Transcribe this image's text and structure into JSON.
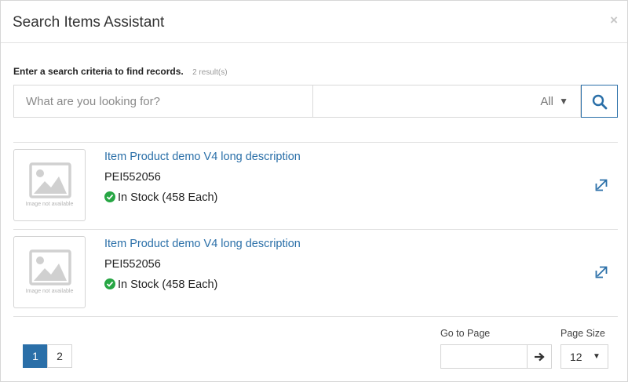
{
  "dialog": {
    "title": "Search Items Assistant",
    "close_glyph": "×"
  },
  "search": {
    "criteria_text": "Enter a search criteria to find records.",
    "result_count": "2 result(s)",
    "placeholder": "What are you looking for?",
    "filter_value": "All",
    "filter_caret": "▼",
    "button_icon": "search-icon"
  },
  "results": [
    {
      "name": "Item Product demo V4 long description",
      "code": "PEI552056",
      "stock": "In Stock (458 Each)",
      "thumb_text": "Image not available",
      "stock_color": "#27a644"
    },
    {
      "name": "Item Product demo V4 long description",
      "code": "PEI552056",
      "stock": "In Stock (458 Each)",
      "thumb_text": "Image not available",
      "stock_color": "#27a644"
    }
  ],
  "pagination": {
    "pages": [
      "1",
      "2"
    ],
    "current_page": "1",
    "goto_label": "Go to Page",
    "goto_value": "",
    "page_size_label": "Page Size",
    "page_size_value": "12",
    "page_size_caret": "▼"
  },
  "colors": {
    "accent": "#2a6fa8",
    "in_stock": "#27a644",
    "border": "#d9d9d9"
  }
}
